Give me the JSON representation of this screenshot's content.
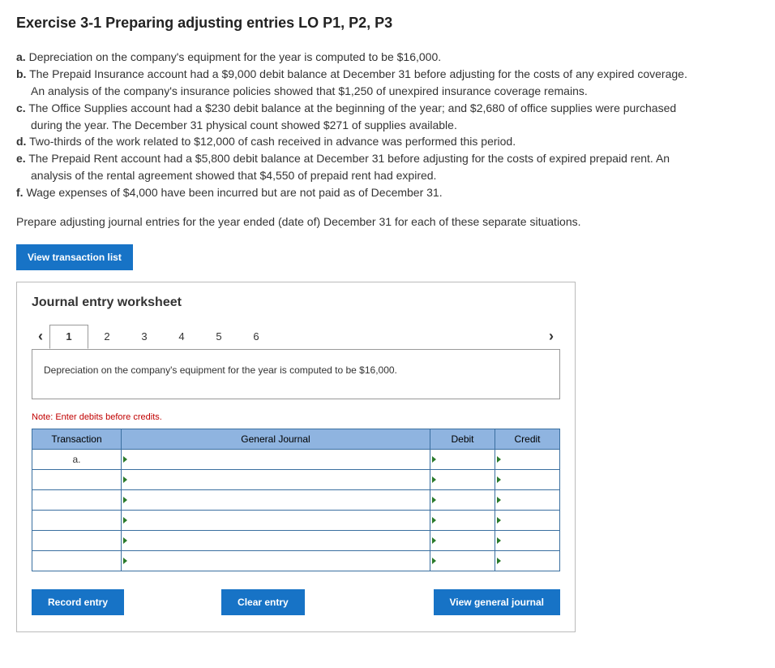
{
  "title": "Exercise 3-1 Preparing adjusting entries LO P1, P2, P3",
  "items": {
    "a": "Depreciation on the company's equipment for the year is computed to be $16,000.",
    "b1": "The Prepaid Insurance account had a $9,000 debit balance at December 31 before adjusting for the costs of any expired coverage.",
    "b2": "An analysis of the company's insurance policies showed that $1,250 of unexpired insurance coverage remains.",
    "c1": "The Office Supplies account had a $230 debit balance at the beginning of the year; and $2,680 of office supplies were purchased",
    "c2": "during the year. The December 31 physical count showed $271 of supplies available.",
    "d": "Two-thirds of the work related to $12,000 of cash received in advance was performed this period.",
    "e1": "The Prepaid Rent account had a $5,800 debit balance at December 31 before adjusting for the costs of expired prepaid rent. An",
    "e2": "analysis of the rental agreement showed that $4,550 of prepaid rent had expired.",
    "f": "Wage expenses of $4,000 have been incurred but are not paid as of December 31."
  },
  "labels": {
    "a": "a.",
    "b": "b.",
    "c": "c.",
    "d": "d.",
    "e": "e.",
    "f": "f."
  },
  "prepare": "Prepare adjusting journal entries for the year ended (date of) December 31 for each of these separate situations.",
  "buttons": {
    "view_transaction_list": "View transaction list",
    "record_entry": "Record entry",
    "clear_entry": "Clear entry",
    "view_general_journal": "View general journal"
  },
  "worksheet": {
    "title": "Journal entry worksheet",
    "tabs": [
      "1",
      "2",
      "3",
      "4",
      "5",
      "6"
    ],
    "active_tab": "1",
    "description": "Depreciation on the company's equipment for the year is computed to be $16,000.",
    "note": "Note: Enter debits before credits.",
    "headers": {
      "transaction": "Transaction",
      "general_journal": "General Journal",
      "debit": "Debit",
      "credit": "Credit"
    },
    "rows": [
      {
        "transaction": "a.",
        "general_journal": "",
        "debit": "",
        "credit": ""
      },
      {
        "transaction": "",
        "general_journal": "",
        "debit": "",
        "credit": ""
      },
      {
        "transaction": "",
        "general_journal": "",
        "debit": "",
        "credit": ""
      },
      {
        "transaction": "",
        "general_journal": "",
        "debit": "",
        "credit": ""
      },
      {
        "transaction": "",
        "general_journal": "",
        "debit": "",
        "credit": ""
      },
      {
        "transaction": "",
        "general_journal": "",
        "debit": "",
        "credit": ""
      }
    ]
  }
}
